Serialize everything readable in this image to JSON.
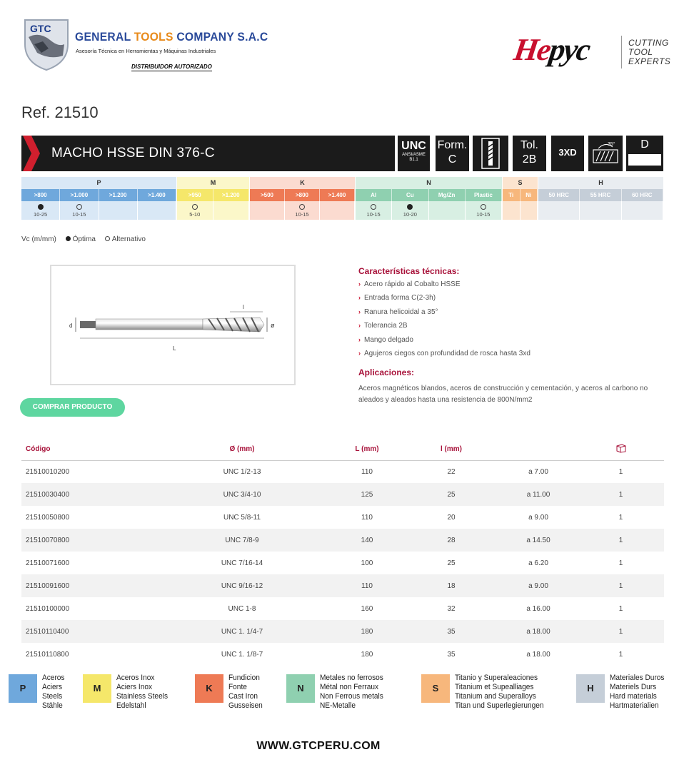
{
  "header": {
    "gtc_abbr": "GTC",
    "gtc_name_a": "GENERAL ",
    "gtc_name_b": "TOOLS",
    "gtc_name_c": " COMPANY S.A.C",
    "gtc_subtitle": "Asesoría Técnica en Herramientas y Máquinas Industriales",
    "gtc_distributor": "DISTRIBUIDOR AUTORIZADO",
    "hepyc_logo_a": "He",
    "hepyc_logo_b": "pyc",
    "hepyc_tag_1": "CUTTING",
    "hepyc_tag_2": "TOOL",
    "hepyc_tag_3": "EXPERTS"
  },
  "product": {
    "ref": "Ref. 21510",
    "title": "MACHO HSSE DIN 376-C",
    "badges": {
      "unc": "UNC",
      "unc_sub_1": "ANSI/ASME",
      "unc_sub_2": "B1.1",
      "form_label": "Form.",
      "form_value": "C",
      "tol_label": "Tol.",
      "tol_value": "2B",
      "depth": "3XD",
      "helix": "35°",
      "d_label": "D"
    }
  },
  "materials": {
    "P": {
      "label": "P",
      "cols": [
        ">800",
        ">1.000",
        ">1.200",
        ">1.400"
      ],
      "vals": [
        "10-25",
        "10-15",
        "",
        ""
      ]
    },
    "M": {
      "label": "M",
      "cols": [
        ">950",
        ">1.200"
      ],
      "vals": [
        "5-10",
        ""
      ]
    },
    "K": {
      "label": "K",
      "cols": [
        ">500",
        ">800",
        ">1.400"
      ],
      "vals": [
        "",
        "10-15",
        ""
      ]
    },
    "N": {
      "label": "N",
      "cols": [
        "Al",
        "Cu",
        "Mg/Zn",
        "Plastic"
      ],
      "vals": [
        "10-15",
        "10-20",
        "",
        "10-15"
      ]
    },
    "S": {
      "label": "S",
      "cols": [
        "Ti",
        "Ni"
      ],
      "vals": [
        "",
        ""
      ]
    },
    "H": {
      "label": "H",
      "cols": [
        "50 HRC",
        "55 HRC",
        "60 HRC"
      ],
      "vals": [
        "",
        "",
        ""
      ]
    }
  },
  "legend": {
    "vc": "Vc (m/mm)",
    "optimal": "Óptima",
    "alternative": "Alternativo"
  },
  "drawing": {
    "d": "d",
    "l_small": "l",
    "L": "L",
    "phi": "ø"
  },
  "characteristics": {
    "title": "Características técnicas:",
    "items": [
      "Acero rápido al Cobalto HSSE",
      "Entrada forma C(2-3h)",
      "Ranura helicoidal a 35°",
      "Tolerancia 2B",
      "Mango delgado",
      "Agujeros ciegos con profundidad de rosca hasta 3xd"
    ]
  },
  "applications": {
    "title": "Aplicaciones:",
    "text": "Aceros magnéticos blandos, aceros de construcción y cementación, y aceros al carbono no aleados y aleados hasta una resistencia de 800N/mm2"
  },
  "buy_button": "COMPRAR PRODUCTO",
  "table": {
    "headers": [
      "Código",
      "Ø (mm)",
      "L (mm)",
      "l (mm)"
    ],
    "rows": [
      [
        "21510010200",
        "UNC 1/2-13",
        "110",
        "22",
        "a 7.00",
        "1"
      ],
      [
        "21510030400",
        "UNC 3/4-10",
        "125",
        "25",
        "a 11.00",
        "1"
      ],
      [
        "21510050800",
        "UNC 5/8-11",
        "110",
        "20",
        "a 9.00",
        "1"
      ],
      [
        "21510070800",
        "UNC 7/8-9",
        "140",
        "28",
        "a 14.50",
        "1"
      ],
      [
        "21510071600",
        "UNC 7/16-14",
        "100",
        "25",
        "a 6.20",
        "1"
      ],
      [
        "21510091600",
        "UNC 9/16-12",
        "110",
        "18",
        "a 9.00",
        "1"
      ],
      [
        "21510100000",
        "UNC 1-8",
        "160",
        "32",
        "a 16.00",
        "1"
      ],
      [
        "21510110400",
        "UNC 1. 1/4-7",
        "180",
        "35",
        "a 18.00",
        "1"
      ],
      [
        "21510110800",
        "UNC 1. 1/8-7",
        "180",
        "35",
        "a 18.00",
        "1"
      ]
    ]
  },
  "bottom_legend": [
    {
      "letter": "P",
      "lines": [
        "Aceros",
        "Aciers",
        "Steels",
        "Stähle"
      ]
    },
    {
      "letter": "M",
      "lines": [
        "Aceros Inox",
        "Aciers Inox",
        "Stainless Steels",
        "Edelstahl"
      ]
    },
    {
      "letter": "K",
      "lines": [
        "Fundicion",
        "Fonte",
        "Cast Iron",
        "Gusseisen"
      ]
    },
    {
      "letter": "N",
      "lines": [
        "Metales no ferrosos",
        "Métal non Ferraux",
        "Non Ferrous metals",
        "NE-Metalle"
      ]
    },
    {
      "letter": "S",
      "lines": [
        "Titanio y Superaleaciones",
        "Titanium et Supealliages",
        "Titanium and Superalloys",
        "Titan und Superlegierungen"
      ]
    },
    {
      "letter": "H",
      "lines": [
        "Materiales Duros",
        "Materiels Durs",
        "Hard materials",
        "Hartmaterialien"
      ]
    }
  ],
  "website": "WWW.GTCPERU.COM",
  "colors": {
    "P": "#6fa8dc",
    "P_light": "#d9e8f6",
    "M": "#f5e76a",
    "M_light": "#fbf7c9",
    "K": "#ee7a55",
    "K_light": "#fbdbd0",
    "N": "#8fd0b0",
    "N_light": "#d8efe3",
    "S": "#f7b77c",
    "S_light": "#fce4cf",
    "H": "#c5ced8",
    "H_light": "#e9edf1",
    "accent": "#a8123a"
  }
}
